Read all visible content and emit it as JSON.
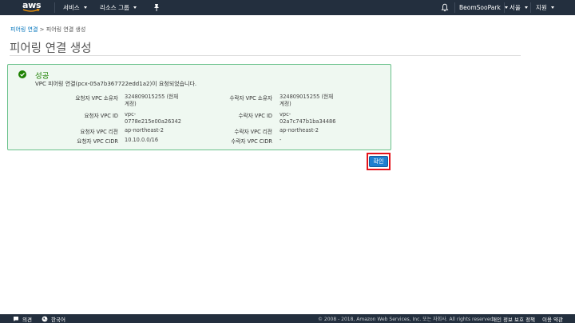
{
  "topbar": {
    "logo_text": "aws",
    "services": "서비스",
    "resource_groups": "리소스 그룹",
    "pin_icon": "pin-icon",
    "bell_icon": "bell-icon",
    "account": "BeomSooPark",
    "region": "서울",
    "support": "지원"
  },
  "breadcrumb": {
    "parent": "피어링 연결",
    "separator": " > ",
    "current": "피어링 연결 생성"
  },
  "page_title": "피어링 연결 생성",
  "success": {
    "title": "성공",
    "message": "VPC 피어링 연결(pcx-05a7b367722edd1a2)이 요청되었습니다.",
    "details": {
      "requester_owner_label": "요청자 VPC 소유자",
      "requester_owner_value_1": "324809015255 (현재",
      "requester_owner_value_2": "계정)",
      "accepter_owner_label": "수락자 VPC 소유자",
      "accepter_owner_value_1": "324809015255 (현재",
      "accepter_owner_value_2": "계정)",
      "requester_vpc_label": "요청자 VPC ID",
      "requester_vpc_value_1": "vpc-",
      "requester_vpc_value_2": "0778e215e00a26342",
      "accepter_vpc_label": "수락자 VPC ID",
      "accepter_vpc_value_1": "vpc-",
      "accepter_vpc_value_2": "02a7c747b1ba34486",
      "requester_region_label": "요청자 VPC 리전",
      "requester_region_value": "ap-northeast-2",
      "accepter_region_label": "수락자 VPC 리전",
      "accepter_region_value": "ap-northeast-2",
      "requester_cidr_label": "요청자 VPC CIDR",
      "requester_cidr_value": "10.10.0.0/16",
      "accepter_cidr_label": "수락자 VPC CIDR",
      "accepter_cidr_value": "-"
    }
  },
  "confirm_button": "확인",
  "footer": {
    "feedback": "의견",
    "language": "한국어",
    "copyright": "© 2008 - 2018, Amazon Web Services, Inc. 또는 자회사. All rights reserved.",
    "privacy": "개인 정보 보호 정책",
    "terms": "이용 약관"
  },
  "colors": {
    "nav_bg": "#232f3e",
    "link": "#0073bb",
    "success_green": "#1d8102",
    "panel_border": "#6ac18b",
    "button": "#1f7fcf",
    "highlight_red": "#e4141b"
  }
}
